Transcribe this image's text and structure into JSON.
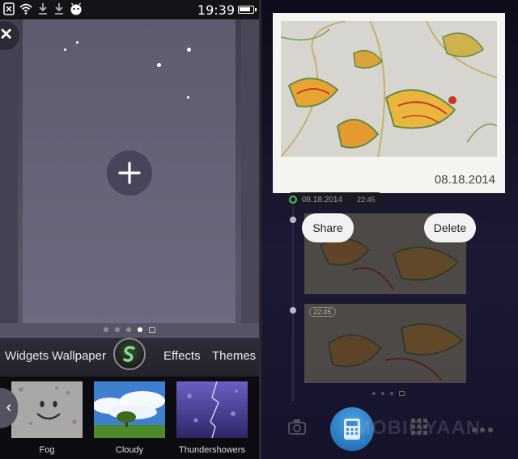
{
  "status_bar": {
    "time": "19:39",
    "battery_level": 0.85,
    "icons": [
      "sim-off-icon",
      "wifi-icon",
      "download-icon",
      "download-icon",
      "android-robot-icon",
      "battery-icon"
    ]
  },
  "launcher": {
    "close_icon": "close-icon",
    "add_icon": "plus-icon",
    "pager": {
      "page_count": 4,
      "active_page": 4,
      "extra_icon": "gallery-icon"
    },
    "menu": {
      "widgets_label": "Widgets",
      "wallpaper_label": "Wallpaper",
      "effects_label": "Effects",
      "themes_label": "Themes",
      "center_icon": "launcher-logo-icon"
    },
    "weather_thumbs": [
      {
        "label": "Fog"
      },
      {
        "label": "Cloudy"
      },
      {
        "label": "Thundershowers"
      }
    ],
    "prev_arrow": "chevron-left-icon"
  },
  "gallery": {
    "photo_date": "08.18.2014",
    "date_chip": {
      "date": "08.18.2014",
      "time": "22:45"
    },
    "popup": {
      "share_label": "Share",
      "delete_label": "Delete"
    },
    "second_photo_tag": "22:45",
    "pager": {
      "page_count": 3,
      "extra_icon": "gallery-icon"
    },
    "dock": [
      "camera-icon",
      "phone-icon",
      "grid-icon",
      "more-icon"
    ],
    "watermark": "MOBIGYAAN",
    "colors": {
      "accent_green": "#42c36a",
      "dock_blue": "#2a7fd0"
    }
  }
}
